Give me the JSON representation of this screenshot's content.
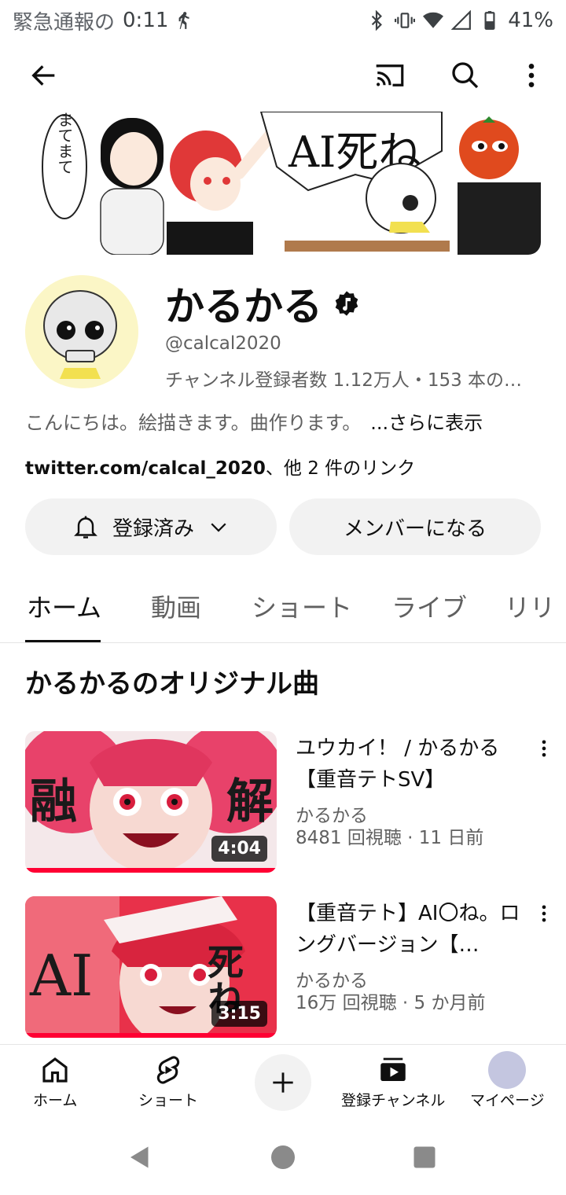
{
  "status_bar": {
    "emergency": "緊急通報の",
    "time": "0:11",
    "battery": "41%"
  },
  "banner": {
    "bubble_text": "まてまて",
    "sign_text": "AI死ね"
  },
  "channel": {
    "name": "かるかる",
    "handle": "@calcal2020",
    "stats": "チャンネル登録者数 1.12万人・153 本の…",
    "description": "こんにちは。絵描きます。曲作ります。",
    "description_more": "...さらに表示",
    "link_url": "twitter.com/calcal_2020",
    "link_suffix": "、他 2 件のリンク",
    "subscribed_label": "登録済み",
    "member_label": "メンバーになる"
  },
  "tabs": [
    {
      "label": "ホーム",
      "active": true
    },
    {
      "label": "動画"
    },
    {
      "label": "ショート"
    },
    {
      "label": "ライブ"
    },
    {
      "label": "リリ"
    }
  ],
  "section": {
    "title": "かるかるのオリジナル曲"
  },
  "videos": [
    {
      "title": "ユウカイ！ / かるかる【重音テトSV】",
      "channel": "かるかる",
      "meta": "8481 回視聴 · 11 日前",
      "duration": "4:04",
      "thumb_left_text": "融",
      "thumb_right_text": "解"
    },
    {
      "title": "【重音テト】AI〇ね。ロングバージョン【…",
      "channel": "かるかる",
      "meta": "16万 回視聴 · 5 か月前",
      "duration": "3:15",
      "thumb_left_text": "AI",
      "thumb_right_text": "死ね"
    }
  ],
  "bottom_nav": {
    "home": "ホーム",
    "shorts": "ショート",
    "subscriptions": "登録チャンネル",
    "mypage": "マイページ"
  },
  "colors": {
    "accent_red": "#ff0033",
    "pill_bg": "#f2f2f2",
    "secondary_text": "#606060"
  }
}
